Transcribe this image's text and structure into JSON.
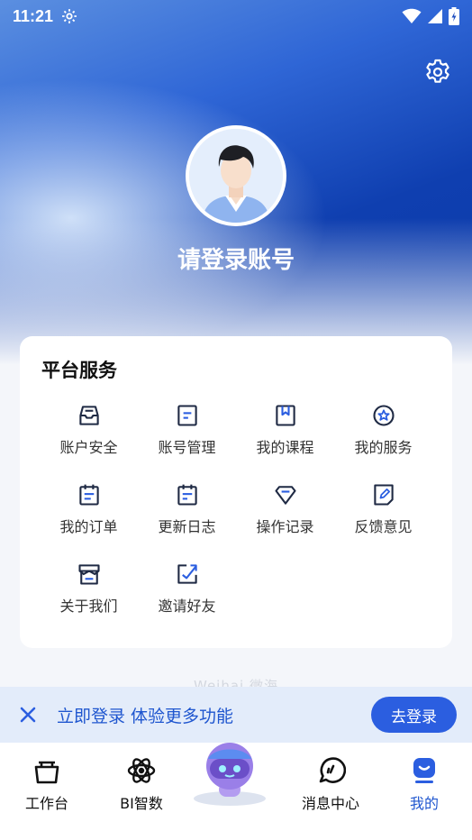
{
  "status_bar": {
    "time": "11:21"
  },
  "profile": {
    "title": "请登录账号"
  },
  "platform_services": {
    "title": "平台服务",
    "items": [
      {
        "label": "账户安全",
        "icon": "inbox-icon"
      },
      {
        "label": "账号管理",
        "icon": "document-icon"
      },
      {
        "label": "我的课程",
        "icon": "bookmark-icon"
      },
      {
        "label": "我的服务",
        "icon": "star-badge-icon"
      },
      {
        "label": "我的订单",
        "icon": "clipboard-icon"
      },
      {
        "label": "更新日志",
        "icon": "calendar-icon"
      },
      {
        "label": "操作记录",
        "icon": "diamond-icon"
      },
      {
        "label": "反馈意见",
        "icon": "edit-icon"
      },
      {
        "label": "关于我们",
        "icon": "store-icon"
      },
      {
        "label": "邀请好友",
        "icon": "share-icon"
      }
    ]
  },
  "watermark": "Weihai 微海",
  "login_banner": {
    "text": "立即登录 体验更多功能",
    "button": "去登录"
  },
  "tabbar": {
    "items": [
      {
        "label": "工作台",
        "icon": "bag-icon"
      },
      {
        "label": "BI智数",
        "icon": "atom-icon"
      },
      {
        "label": "消息中心",
        "icon": "chat-icon"
      },
      {
        "label": "我的",
        "icon": "profile-icon"
      }
    ],
    "active": "我的"
  },
  "colors": {
    "accent": "#2b5ee0",
    "icon": "#1f2a44",
    "banner_bg": "#e3ecfa"
  }
}
